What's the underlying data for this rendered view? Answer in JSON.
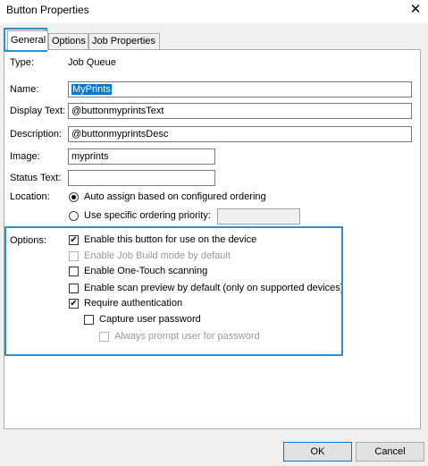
{
  "window": {
    "title": "Button Properties",
    "close_glyph": "✕"
  },
  "tabs": [
    "General",
    "Options",
    "Job Properties"
  ],
  "fields": {
    "type_label": "Type:",
    "type_value": "Job Queue",
    "name_label": "Name:",
    "name_value": "MyPrints",
    "display_text_label": "Display Text:",
    "display_text_value": "@buttonmyprintsText",
    "description_label": "Description:",
    "description_value": "@buttonmyprintsDesc",
    "image_label": "Image:",
    "image_value": "myprints",
    "status_text_label": "Status Text:",
    "status_text_value": ""
  },
  "location": {
    "label": "Location:",
    "auto_assign": "Auto assign based on configured ordering",
    "specific": "Use specific ordering priority:",
    "priority_value": "",
    "selected": "auto_assign"
  },
  "options": {
    "label": "Options:",
    "items": [
      {
        "text": "Enable this button for use on the device",
        "checked": true,
        "enabled": true
      },
      {
        "text": "Enable Job Build mode by default",
        "checked": false,
        "enabled": false
      },
      {
        "text": "Enable One-Touch scanning",
        "checked": false,
        "enabled": true
      },
      {
        "text": "Enable scan preview by default (only on supported devices)",
        "checked": false,
        "enabled": true
      },
      {
        "text": "Require authentication",
        "checked": true,
        "enabled": true
      },
      {
        "text": "Capture user password",
        "checked": false,
        "enabled": true
      },
      {
        "text": "Always prompt user for password",
        "checked": false,
        "enabled": false
      }
    ]
  },
  "buttons": {
    "ok": "OK",
    "cancel": "Cancel"
  },
  "colors": {
    "highlight": "#2a90d0",
    "selection": "#0078d7"
  }
}
